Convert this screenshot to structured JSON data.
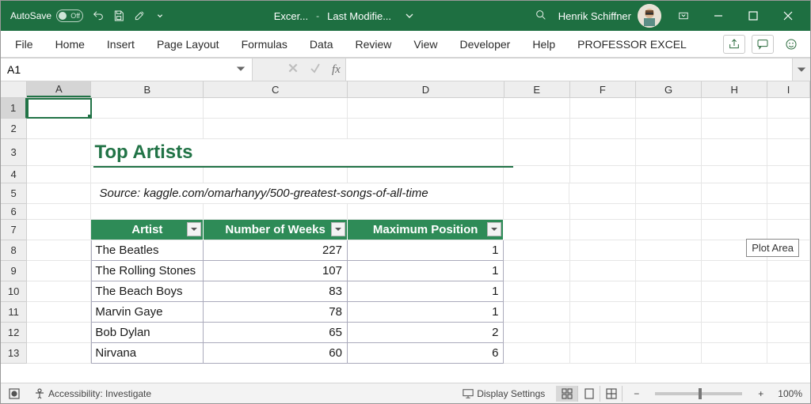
{
  "titlebar": {
    "autosave_label": "AutoSave",
    "autosave_state": "Off",
    "doc_name": "Excer...",
    "doc_status": "Last Modifie...",
    "user_name": "Henrik Schiffner"
  },
  "ribbon": {
    "tabs": [
      "File",
      "Home",
      "Insert",
      "Page Layout",
      "Formulas",
      "Data",
      "Review",
      "View",
      "Developer",
      "Help",
      "PROFESSOR EXCEL"
    ]
  },
  "namebox": {
    "value": "A1"
  },
  "formula_bar": {
    "fx_label": "fx",
    "value": ""
  },
  "columns": [
    "A",
    "B",
    "C",
    "D",
    "E",
    "F",
    "G",
    "H",
    "I"
  ],
  "rows": [
    "1",
    "2",
    "3",
    "4",
    "5",
    "6",
    "7",
    "8",
    "9",
    "10",
    "11",
    "12",
    "13"
  ],
  "sheet": {
    "title": "Top Artists",
    "source": "Source: kaggle.com/omarhanyy/500-greatest-songs-of-all-time",
    "headers": {
      "artist": "Artist",
      "weeks": "Number of Weeks",
      "maxpos": "Maximum Position"
    },
    "data": [
      {
        "artist": "The Beatles",
        "weeks": 227,
        "maxpos": 1
      },
      {
        "artist": "The Rolling Stones",
        "weeks": 107,
        "maxpos": 1
      },
      {
        "artist": "The Beach Boys",
        "weeks": 83,
        "maxpos": 1
      },
      {
        "artist": "Marvin Gaye",
        "weeks": 78,
        "maxpos": 1
      },
      {
        "artist": "Bob Dylan",
        "weeks": 65,
        "maxpos": 2
      },
      {
        "artist": "Nirvana",
        "weeks": 60,
        "maxpos": 6
      }
    ]
  },
  "plot_tag": "Plot Area",
  "statusbar": {
    "accessibility": "Accessibility: Investigate",
    "display_settings": "Display Settings",
    "zoom": "100%"
  },
  "chart_data": {
    "type": "table",
    "title": "Top Artists",
    "columns": [
      "Artist",
      "Number of Weeks",
      "Maximum Position"
    ],
    "rows": [
      [
        "The Beatles",
        227,
        1
      ],
      [
        "The Rolling Stones",
        107,
        1
      ],
      [
        "The Beach Boys",
        83,
        1
      ],
      [
        "Marvin Gaye",
        78,
        1
      ],
      [
        "Bob Dylan",
        65,
        2
      ],
      [
        "Nirvana",
        60,
        6
      ]
    ]
  }
}
